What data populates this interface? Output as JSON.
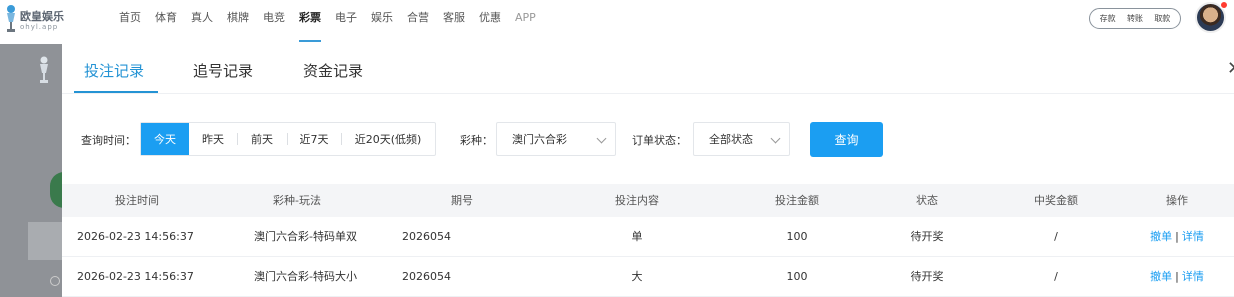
{
  "brand": {
    "name_cn": "欧皇娱乐",
    "name_en": "ohyl.app",
    "accent": "#1b9ef2",
    "tab_accent": "#2493d4"
  },
  "nav": [
    {
      "label": "首页",
      "active": false
    },
    {
      "label": "体育",
      "active": false
    },
    {
      "label": "真人",
      "active": false
    },
    {
      "label": "棋牌",
      "active": false
    },
    {
      "label": "电竞",
      "active": false
    },
    {
      "label": "彩票",
      "active": true
    },
    {
      "label": "电子",
      "active": false
    },
    {
      "label": "娱乐",
      "active": false
    },
    {
      "label": "合营",
      "active": false
    },
    {
      "label": "客服",
      "active": false
    },
    {
      "label": "优惠",
      "active": false
    },
    {
      "label": "APP",
      "active": false
    }
  ],
  "account": {
    "deposit": "存款",
    "transfer": "转账",
    "withdraw": "取款"
  },
  "modal": {
    "tabs": [
      "投注记录",
      "追号记录",
      "资金记录"
    ],
    "active_tab": 0,
    "close_icon": "close-icon"
  },
  "filter": {
    "time_label": "查询时间：",
    "time_options": [
      "今天",
      "昨天",
      "前天",
      "近7天",
      "近20天(低频)"
    ],
    "time_selected": 0,
    "lottery_label": "彩种：",
    "lottery_value": "澳门六合彩",
    "status_label": "订单状态：",
    "status_value": "全部状态",
    "query_label": "查询"
  },
  "table": {
    "headers": [
      "投注时间",
      "彩种-玩法",
      "期号",
      "投注内容",
      "投注金额",
      "状态",
      "中奖金额",
      "操作"
    ],
    "rows": [
      {
        "time": "2026-02-23 14:56:37",
        "game": "澳门六合彩-特码单双",
        "issue": "2026054",
        "content": "单",
        "amount": "100",
        "status": "待开奖",
        "win": "/",
        "op_cancel": "撤单",
        "op_sep": "|",
        "op_detail": "详情"
      },
      {
        "time": "2026-02-23 14:56:37",
        "game": "澳门六合彩-特码大小",
        "issue": "2026054",
        "content": "大",
        "amount": "100",
        "status": "待开奖",
        "win": "/",
        "op_cancel": "撤单",
        "op_sep": "|",
        "op_detail": "详情"
      }
    ]
  }
}
